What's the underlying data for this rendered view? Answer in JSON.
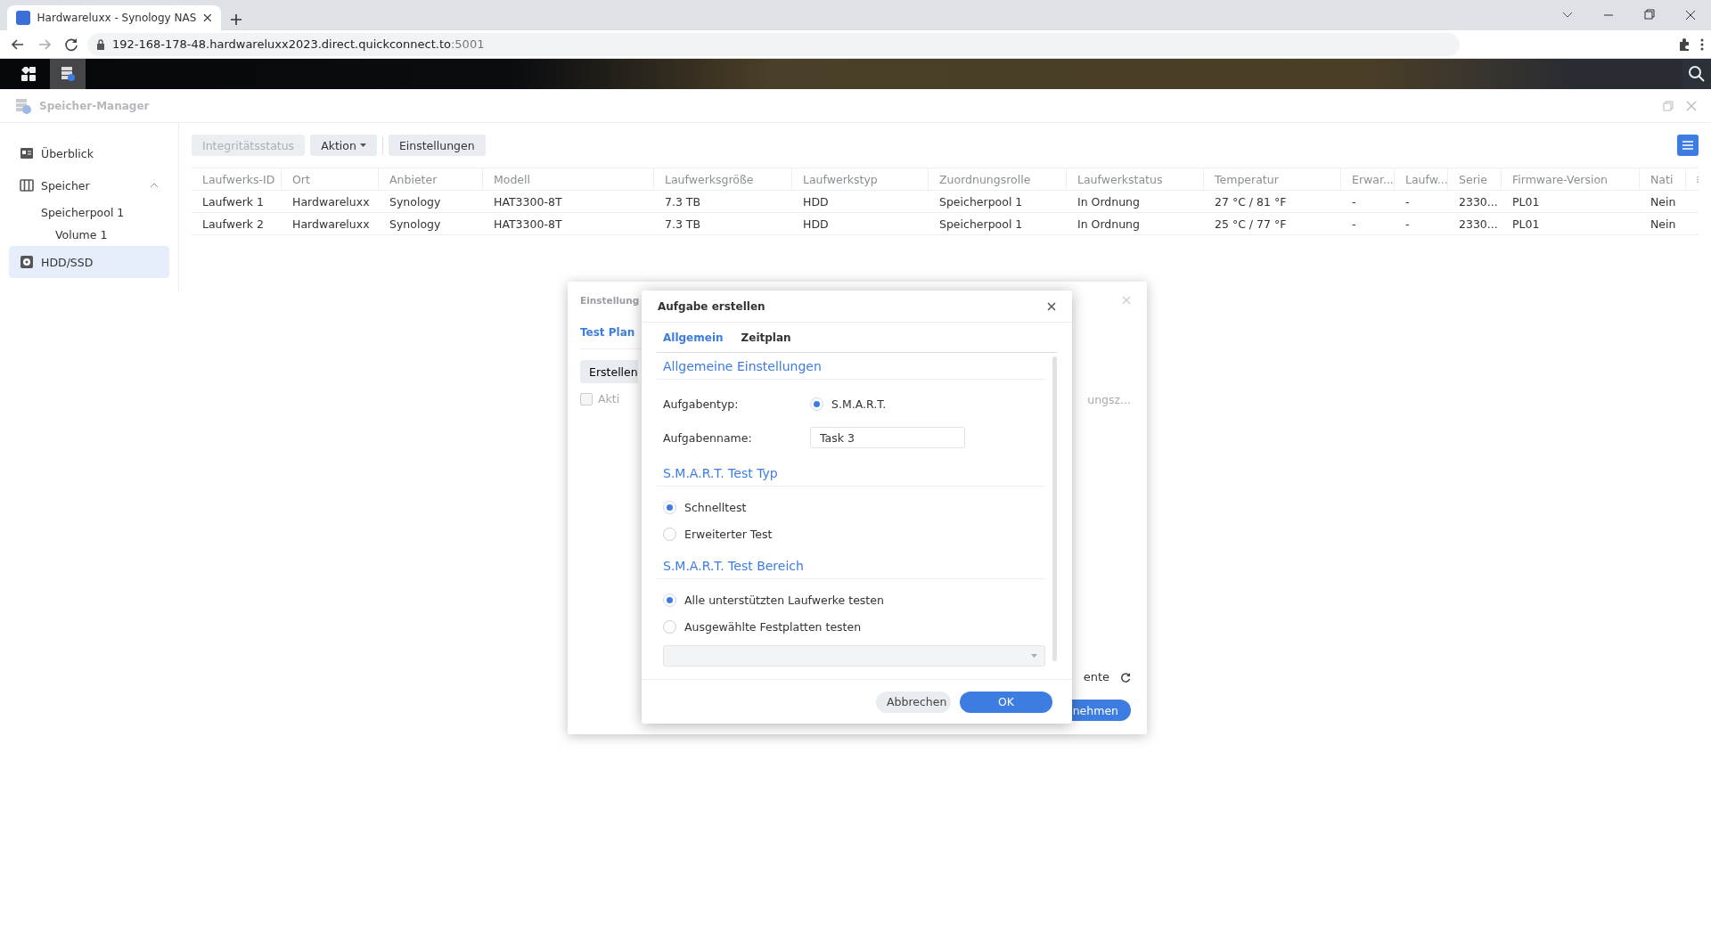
{
  "browser": {
    "tab_title": "Hardwareluxx - Synology NAS",
    "url_host": "192-168-178-48.hardwareluxx2023.direct.quickconnect.to",
    "url_port": ":5001"
  },
  "window": {
    "title": "Speicher-Manager"
  },
  "sidebar": {
    "items": [
      {
        "label": "Überblick",
        "selected": false
      },
      {
        "label": "Speicher",
        "selected": false,
        "expanded": true,
        "children": [
          {
            "label": "Speicherpool 1",
            "selected": false,
            "children": [
              {
                "label": "Volume 1",
                "selected": false
              }
            ]
          }
        ]
      },
      {
        "label": "HDD/SSD",
        "selected": true
      }
    ]
  },
  "toolbar": {
    "buttons": [
      {
        "label": "Integritätsstatus",
        "disabled": true,
        "dropdown": false
      },
      {
        "label": "Aktion",
        "disabled": false,
        "dropdown": true
      },
      {
        "label": "Einstellungen",
        "disabled": false,
        "dropdown": false
      }
    ]
  },
  "table": {
    "columns": [
      "Laufwerks-ID",
      "Ort",
      "Anbieter",
      "Modell",
      "Laufwerksgröße",
      "Laufwerkstyp",
      "Zuordnungsrolle",
      "Laufwerkstatus",
      "Temperatur",
      "Erwar...",
      "Laufw...",
      "Serie",
      "Firmware-Version",
      "Nati"
    ],
    "rows": [
      [
        "Laufwerk 1",
        "Hardwareluxx",
        "Synology",
        "HAT3300-8T",
        "7.3 TB",
        "HDD",
        "Speicherpool 1",
        "In Ordnung",
        "27 °C / 81 °F",
        "-",
        "-",
        "2330...",
        "PL01",
        "Nein"
      ],
      [
        "Laufwerk 2",
        "Hardwareluxx",
        "Synology",
        "HAT3300-8T",
        "7.3 TB",
        "HDD",
        "Speicherpool 1",
        "In Ordnung",
        "25 °C / 77 °F",
        "-",
        "-",
        "2330...",
        "PL01",
        "Nein"
      ]
    ]
  },
  "back_dialog": {
    "title": "Einstellung",
    "tab": "Test Plan",
    "create_button": "Erstellen",
    "checkbox_label": "Akti",
    "checkbox_checked": false,
    "column_header": "ungsz...",
    "footer_text": "ente",
    "apply_button": "nehmen"
  },
  "dialog": {
    "title": "Aufgabe erstellen",
    "tabs": [
      {
        "label": "Allgemein",
        "selected": true
      },
      {
        "label": "Zeitplan",
        "selected": false
      }
    ],
    "sections": [
      {
        "heading": "Allgemeine Einstellungen",
        "fields": [
          {
            "kind": "radio",
            "label": "Aufgabentyp:",
            "option": "S.M.A.R.T.",
            "selected": true
          },
          {
            "kind": "text",
            "label": "Aufgabenname:",
            "value": "Task 3"
          }
        ]
      },
      {
        "heading": "S.M.A.R.T. Test Typ",
        "options": [
          {
            "label": "Schnelltest",
            "selected": true
          },
          {
            "label": "Erweiterter Test",
            "selected": false
          }
        ]
      },
      {
        "heading": "S.M.A.R.T. Test Bereich",
        "options": [
          {
            "label": "Alle unterstützten Laufwerke testen",
            "selected": true
          },
          {
            "label": "Ausgewählte Festplatten testen",
            "selected": false
          }
        ],
        "dropdown_disabled": true
      }
    ],
    "buttons": [
      {
        "label": "Abbrechen",
        "kind": "secondary"
      },
      {
        "label": "OK",
        "kind": "primary"
      }
    ]
  }
}
